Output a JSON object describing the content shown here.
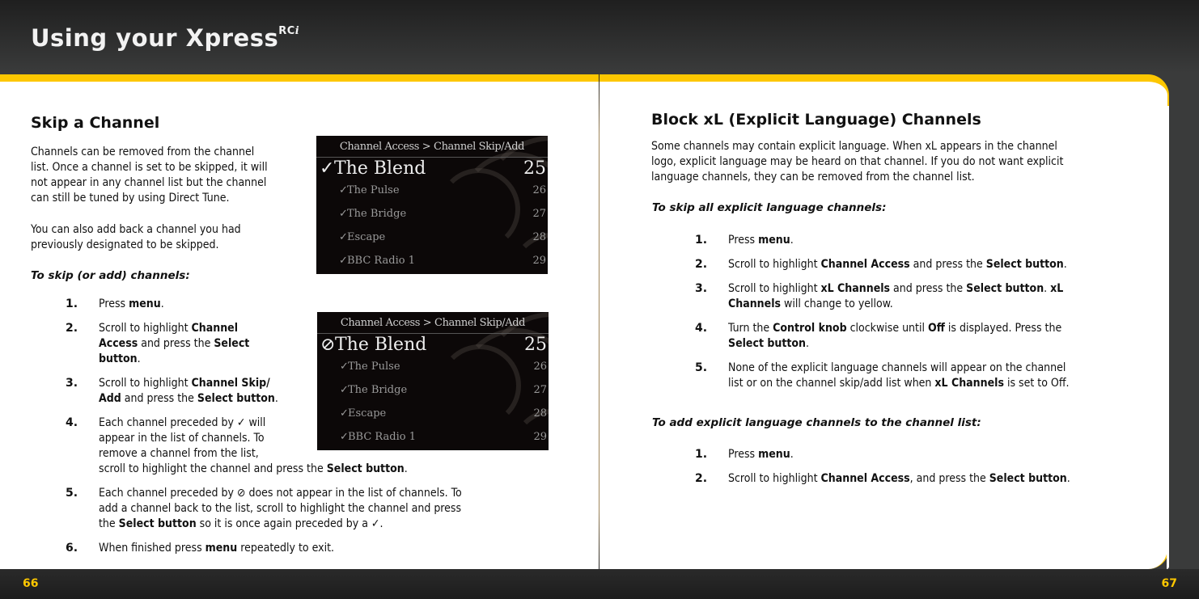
{
  "header": {
    "title": "Using your Xpress",
    "title_sup": "RC",
    "title_sup_italic": "i"
  },
  "colors": {
    "accent": "#fdc700",
    "header_bg": "#3a3b3b",
    "page_bg": "#ffffff",
    "text": "#111111"
  },
  "left_page": {
    "heading": "Skip a Channel",
    "intro_lines": [
      "Channels can be removed from the channel",
      "list. Once a channel is set to be skipped, it will",
      "not appear in any channel list but the channel",
      "can still be tuned by using Direct Tune."
    ],
    "add_back_lines": [
      "You can also add back a channel you had",
      "previously designated to be skipped."
    ],
    "lead": "To skip (or add) channels:",
    "steps": [
      {
        "num": "1.",
        "parts": [
          [
            "Press ",
            false
          ],
          [
            "menu",
            true
          ],
          [
            ".",
            false
          ]
        ]
      },
      {
        "num": "2.",
        "parts": [
          [
            "Scroll to highlight ",
            false
          ],
          [
            "Channel",
            true
          ],
          [
            "\n",
            false
          ],
          [
            "Access",
            true
          ],
          [
            " and press the ",
            false
          ],
          [
            "Select",
            true
          ],
          [
            "\n",
            false
          ],
          [
            "button",
            true
          ],
          [
            ".",
            false
          ]
        ]
      },
      {
        "num": "3.",
        "parts": [
          [
            "Scroll to highlight ",
            false
          ],
          [
            "Channel Skip/",
            true
          ],
          [
            "\n",
            false
          ],
          [
            "Add",
            true
          ],
          [
            " and press the ",
            false
          ],
          [
            "Select button",
            true
          ],
          [
            ".",
            false
          ]
        ]
      },
      {
        "num": "4.",
        "parts": [
          [
            "Each channel preceded by ✓ will",
            false
          ],
          [
            "\n",
            false
          ],
          [
            "appear in the list of channels. To",
            false
          ],
          [
            "\n",
            false
          ],
          [
            "remove a channel from the list,",
            false
          ],
          [
            "\n",
            false
          ],
          [
            "scroll to highlight the channel and press the ",
            false
          ],
          [
            "Select button",
            true
          ],
          [
            ".",
            false
          ]
        ]
      },
      {
        "num": "5.",
        "parts": [
          [
            "Each channel preceded by ⊘ does not appear in the list of channels. To",
            false
          ],
          [
            "\n",
            false
          ],
          [
            "add a channel back to the list, scroll to highlight the channel and press",
            false
          ],
          [
            "\n",
            false
          ],
          [
            "the ",
            false
          ],
          [
            "Select button",
            true
          ],
          [
            " so it is once again preceded by a ✓.",
            false
          ]
        ]
      },
      {
        "num": "6.",
        "parts": [
          [
            "When finished press ",
            false
          ],
          [
            "menu",
            true
          ],
          [
            " repeatedly to exit.",
            false
          ]
        ]
      }
    ],
    "page_number": "66",
    "screens": [
      {
        "title": "Channel Access > Channel Skip/Add",
        "rows": [
          {
            "mark": "✓",
            "name": "The Blend",
            "channel": "25",
            "highlighted": true
          },
          {
            "mark": "✓",
            "name": "The Pulse",
            "channel": "26",
            "highlighted": false
          },
          {
            "mark": "✓",
            "name": "The Bridge",
            "channel": "27",
            "highlighted": false
          },
          {
            "mark": "✓",
            "name": "Escape",
            "channel": "28",
            "highlighted": false
          },
          {
            "mark": "✓",
            "name": "BBC Radio 1",
            "channel": "29",
            "highlighted": false
          }
        ]
      },
      {
        "title": "Channel Access > Channel Skip/Add",
        "rows": [
          {
            "mark": "⊘",
            "name": "The Blend",
            "channel": "25",
            "highlighted": true
          },
          {
            "mark": "✓",
            "name": "The Pulse",
            "channel": "26",
            "highlighted": false
          },
          {
            "mark": "✓",
            "name": "The Bridge",
            "channel": "27",
            "highlighted": false
          },
          {
            "mark": "✓",
            "name": "Escape",
            "channel": "28",
            "highlighted": false
          },
          {
            "mark": "✓",
            "name": "BBC Radio 1",
            "channel": "29",
            "highlighted": false
          }
        ]
      }
    ]
  },
  "right_page": {
    "heading": "Block xL (Explicit Language) Channels",
    "intro_lines": [
      "Some channels may contain explicit language. When xL appears in the channel",
      "logo, explicit language may be heard on that channel. If you do not want explicit",
      "language channels, they can be removed from the channel list."
    ],
    "lead_skip": "To skip all explicit language channels:",
    "skip_steps": [
      {
        "num": "1.",
        "parts": [
          [
            "Press ",
            false
          ],
          [
            "menu",
            true
          ],
          [
            ".",
            false
          ]
        ]
      },
      {
        "num": "2.",
        "parts": [
          [
            "Scroll to highlight ",
            false
          ],
          [
            "Channel Access",
            true
          ],
          [
            " and press the ",
            false
          ],
          [
            "Select button",
            true
          ],
          [
            ".",
            false
          ]
        ]
      },
      {
        "num": "3.",
        "parts": [
          [
            "Scroll to highlight ",
            false
          ],
          [
            "xL Channels",
            true
          ],
          [
            " and press the ",
            false
          ],
          [
            "Select button",
            true
          ],
          [
            ". ",
            false
          ],
          [
            "xL",
            true
          ],
          [
            "\n",
            false
          ],
          [
            "Channels",
            true
          ],
          [
            " will change to yellow.",
            false
          ]
        ]
      },
      {
        "num": "4.",
        "parts": [
          [
            "Turn the ",
            false
          ],
          [
            "Control knob",
            true
          ],
          [
            " clockwise until ",
            false
          ],
          [
            "Off",
            true
          ],
          [
            " is displayed. Press the",
            false
          ],
          [
            "\n",
            false
          ],
          [
            "Select button",
            true
          ],
          [
            ".",
            false
          ]
        ]
      },
      {
        "num": "5.",
        "parts": [
          [
            "None of the explicit language channels will appear on the channel",
            false
          ],
          [
            "\n",
            false
          ],
          [
            "list or on the channel skip/add list when ",
            false
          ],
          [
            "xL Channels",
            true
          ],
          [
            " is set to Off.",
            false
          ]
        ]
      }
    ],
    "lead_add": "To add explicit language channels to the channel list:",
    "add_steps": [
      {
        "num": "1.",
        "parts": [
          [
            "Press ",
            false
          ],
          [
            "menu",
            true
          ],
          [
            ".",
            false
          ]
        ]
      },
      {
        "num": "2.",
        "parts": [
          [
            "Scroll to highlight ",
            false
          ],
          [
            "Channel Access",
            true
          ],
          [
            ", and press the ",
            false
          ],
          [
            "Select button",
            true
          ],
          [
            ".",
            false
          ]
        ]
      }
    ],
    "page_number": "67"
  }
}
